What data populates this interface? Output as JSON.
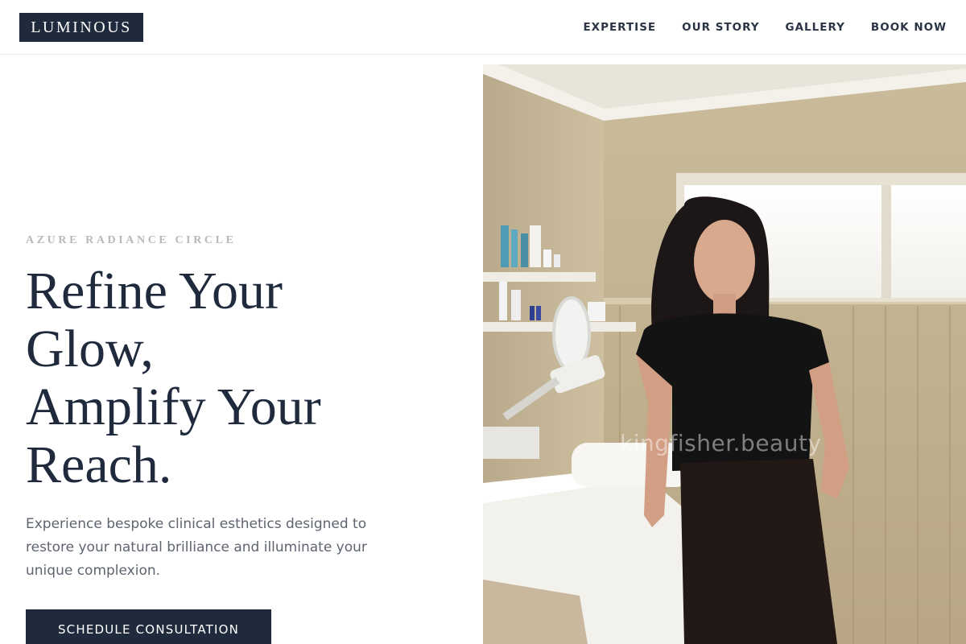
{
  "brand": {
    "logo_text": "LUMINOUS"
  },
  "nav": {
    "items": [
      {
        "label": "EXPERTISE"
      },
      {
        "label": "OUR STORY"
      },
      {
        "label": "GALLERY"
      },
      {
        "label": "BOOK NOW"
      }
    ]
  },
  "hero": {
    "eyebrow": "AZURE RADIANCE CIRCLE",
    "headline_lines": [
      "Refine Your",
      "Glow,",
      "Amplify Your",
      "Reach."
    ],
    "description": "Experience bespoke clinical esthetics designed to restore your natural brilliance and illuminate your unique complexion.",
    "cta_label": "SCHEDULE CONSULTATION",
    "image_watermark": "kingfisher.beauty"
  },
  "colors": {
    "brand_navy": "#1f2a3d",
    "eyebrow_gray": "#b9b9b9",
    "body_text": "#5e6470"
  },
  "icons": []
}
